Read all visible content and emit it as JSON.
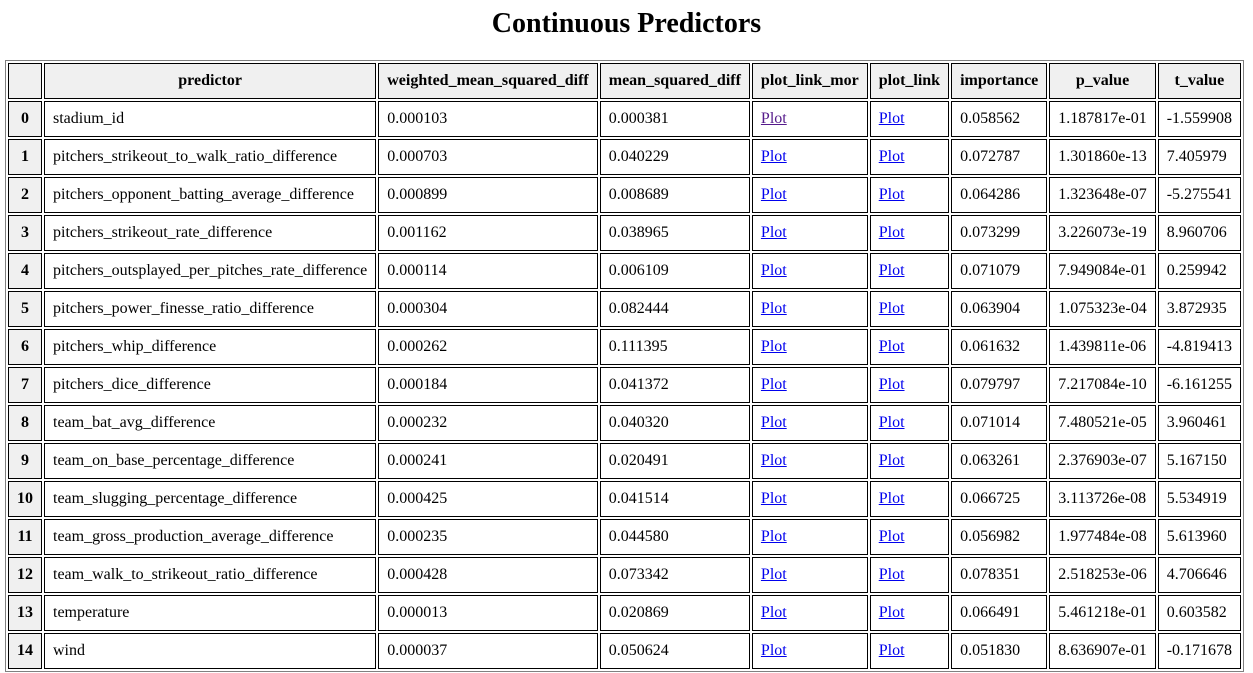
{
  "page": {
    "title": "Continuous Predictors"
  },
  "table": {
    "columns": [
      "",
      "predictor",
      "weighted_mean_squared_diff",
      "mean_squared_diff",
      "plot_link_mor",
      "plot_link",
      "importance",
      "p_value",
      "t_value"
    ],
    "link_label": "Plot",
    "link_colors": {
      "visited": "#551a8b",
      "unvisited": "#0000ee"
    },
    "rows": [
      {
        "index": "0",
        "predictor": "stadium_id",
        "weighted_mean_squared_diff": "0.000103",
        "mean_squared_diff": "0.000381",
        "plot_link_mor": "Plot",
        "plot_link": "Plot",
        "importance": "0.058562",
        "p_value": "1.187817e-01",
        "t_value": "-1.559908"
      },
      {
        "index": "1",
        "predictor": "pitchers_strikeout_to_walk_ratio_difference",
        "weighted_mean_squared_diff": "0.000703",
        "mean_squared_diff": "0.040229",
        "plot_link_mor": "Plot",
        "plot_link": "Plot",
        "importance": "0.072787",
        "p_value": "1.301860e-13",
        "t_value": "7.405979"
      },
      {
        "index": "2",
        "predictor": "pitchers_opponent_batting_average_difference",
        "weighted_mean_squared_diff": "0.000899",
        "mean_squared_diff": "0.008689",
        "plot_link_mor": "Plot",
        "plot_link": "Plot",
        "importance": "0.064286",
        "p_value": "1.323648e-07",
        "t_value": "-5.275541"
      },
      {
        "index": "3",
        "predictor": "pitchers_strikeout_rate_difference",
        "weighted_mean_squared_diff": "0.001162",
        "mean_squared_diff": "0.038965",
        "plot_link_mor": "Plot",
        "plot_link": "Plot",
        "importance": "0.073299",
        "p_value": "3.226073e-19",
        "t_value": "8.960706"
      },
      {
        "index": "4",
        "predictor": "pitchers_outsplayed_per_pitches_rate_difference",
        "weighted_mean_squared_diff": "0.000114",
        "mean_squared_diff": "0.006109",
        "plot_link_mor": "Plot",
        "plot_link": "Plot",
        "importance": "0.071079",
        "p_value": "7.949084e-01",
        "t_value": "0.259942"
      },
      {
        "index": "5",
        "predictor": "pitchers_power_finesse_ratio_difference",
        "weighted_mean_squared_diff": "0.000304",
        "mean_squared_diff": "0.082444",
        "plot_link_mor": "Plot",
        "plot_link": "Plot",
        "importance": "0.063904",
        "p_value": "1.075323e-04",
        "t_value": "3.872935"
      },
      {
        "index": "6",
        "predictor": "pitchers_whip_difference",
        "weighted_mean_squared_diff": "0.000262",
        "mean_squared_diff": "0.111395",
        "plot_link_mor": "Plot",
        "plot_link": "Plot",
        "importance": "0.061632",
        "p_value": "1.439811e-06",
        "t_value": "-4.819413"
      },
      {
        "index": "7",
        "predictor": "pitchers_dice_difference",
        "weighted_mean_squared_diff": "0.000184",
        "mean_squared_diff": "0.041372",
        "plot_link_mor": "Plot",
        "plot_link": "Plot",
        "importance": "0.079797",
        "p_value": "7.217084e-10",
        "t_value": "-6.161255"
      },
      {
        "index": "8",
        "predictor": "team_bat_avg_difference",
        "weighted_mean_squared_diff": "0.000232",
        "mean_squared_diff": "0.040320",
        "plot_link_mor": "Plot",
        "plot_link": "Plot",
        "importance": "0.071014",
        "p_value": "7.480521e-05",
        "t_value": "3.960461"
      },
      {
        "index": "9",
        "predictor": "team_on_base_percentage_difference",
        "weighted_mean_squared_diff": "0.000241",
        "mean_squared_diff": "0.020491",
        "plot_link_mor": "Plot",
        "plot_link": "Plot",
        "importance": "0.063261",
        "p_value": "2.376903e-07",
        "t_value": "5.167150"
      },
      {
        "index": "10",
        "predictor": "team_slugging_percentage_difference",
        "weighted_mean_squared_diff": "0.000425",
        "mean_squared_diff": "0.041514",
        "plot_link_mor": "Plot",
        "plot_link": "Plot",
        "importance": "0.066725",
        "p_value": "3.113726e-08",
        "t_value": "5.534919"
      },
      {
        "index": "11",
        "predictor": "team_gross_production_average_difference",
        "weighted_mean_squared_diff": "0.000235",
        "mean_squared_diff": "0.044580",
        "plot_link_mor": "Plot",
        "plot_link": "Plot",
        "importance": "0.056982",
        "p_value": "1.977484e-08",
        "t_value": "5.613960"
      },
      {
        "index": "12",
        "predictor": "team_walk_to_strikeout_ratio_difference",
        "weighted_mean_squared_diff": "0.000428",
        "mean_squared_diff": "0.073342",
        "plot_link_mor": "Plot",
        "plot_link": "Plot",
        "importance": "0.078351",
        "p_value": "2.518253e-06",
        "t_value": "4.706646"
      },
      {
        "index": "13",
        "predictor": "temperature",
        "weighted_mean_squared_diff": "0.000013",
        "mean_squared_diff": "0.020869",
        "plot_link_mor": "Plot",
        "plot_link": "Plot",
        "importance": "0.066491",
        "p_value": "5.461218e-01",
        "t_value": "0.603582"
      },
      {
        "index": "14",
        "predictor": "wind",
        "weighted_mean_squared_diff": "0.000037",
        "mean_squared_diff": "0.050624",
        "plot_link_mor": "Plot",
        "plot_link": "Plot",
        "importance": "0.051830",
        "p_value": "8.636907e-01",
        "t_value": "-0.171678"
      }
    ]
  }
}
